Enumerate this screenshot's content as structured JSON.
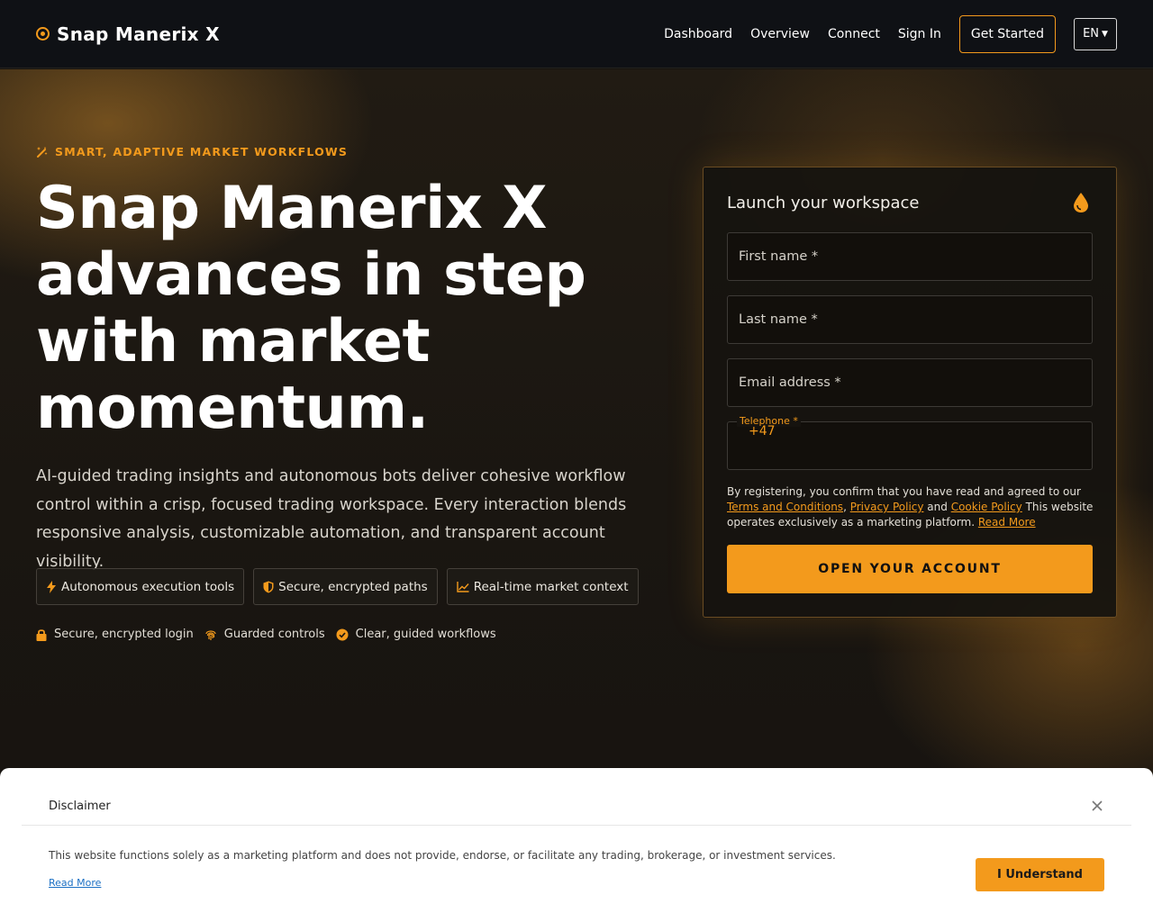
{
  "header": {
    "brand": "Snap Manerix X",
    "nav": [
      "Dashboard",
      "Overview",
      "Connect",
      "Sign In"
    ],
    "cta": "Get Started",
    "language": "EN"
  },
  "hero": {
    "tagline": "SMART, ADAPTIVE MARKET WORKFLOWS",
    "headline": "Snap Manerix X advances in step with market momentum.",
    "lead": "AI-guided trading insights and autonomous bots deliver cohesive workflow control within a crisp, focused trading workspace. Every interaction blends responsive analysis, customizable automation, and transparent account visibility.",
    "chips": [
      {
        "label": "Autonomous execution tools",
        "icon": "lightning-icon"
      },
      {
        "label": "Secure, encrypted paths",
        "icon": "shield-icon"
      },
      {
        "label": "Real-time market context",
        "icon": "chart-line-icon"
      }
    ],
    "trust": [
      {
        "label": "Secure, encrypted login",
        "icon": "lock-icon"
      },
      {
        "label": "Guarded controls",
        "icon": "fingerprint-icon"
      },
      {
        "label": "Clear, guided workflows",
        "icon": "check-circle-icon"
      }
    ]
  },
  "form": {
    "title": "Launch your workspace",
    "first_name_placeholder": "First name *",
    "last_name_placeholder": "Last name *",
    "email_placeholder": "Email address *",
    "telephone_label": "Telephone *",
    "telephone_code": "+47",
    "consent_prefix": "By registering, you confirm that you have read and agreed to our ",
    "terms_link": "Terms and Conditions",
    "comma": ", ",
    "privacy_link": "Privacy Policy",
    "and": " and ",
    "cookie_link": "Cookie Policy",
    "consent_suffix": " This website operates exclusively as a marketing platform. ",
    "read_more": "Read More",
    "submit": "OPEN YOUR ACCOUNT"
  },
  "disclaimer": {
    "title": "Disclaimer",
    "text": "This website functions solely as a marketing platform and does not provide, endorse, or facilitate any trading, brokerage, or investment services.",
    "read_more": "Read More",
    "button": "I Understand"
  },
  "colors": {
    "accent": "#f39a1c",
    "header_bg": "#0f1115",
    "hero_bg": "#1a1611",
    "disclaimer_bg": "#ffffff"
  }
}
